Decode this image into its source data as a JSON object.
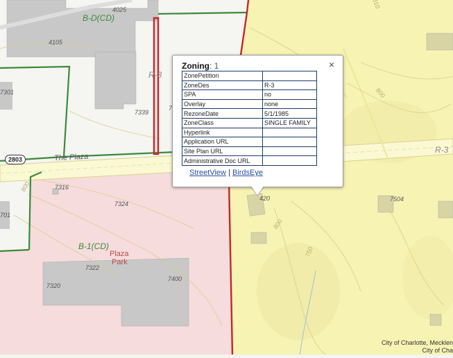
{
  "popup": {
    "title": "Zoning",
    "count": ": 1",
    "close": "×",
    "rows": [
      {
        "key": "ZonePetition",
        "value": ""
      },
      {
        "key": "ZoneDes",
        "value": "R-3"
      },
      {
        "key": "SPA",
        "value": "no"
      },
      {
        "key": "Overlay",
        "value": "none"
      },
      {
        "key": "RezoneDate",
        "value": "5/1/1985"
      },
      {
        "key": "ZoneClass",
        "value": "SINGLE FAMILY"
      },
      {
        "key": "Hyperlink",
        "value": ""
      },
      {
        "key": "Application URL",
        "value": ""
      },
      {
        "key": "Site Plan URL",
        "value": ""
      },
      {
        "key": "Administrative Doc URL",
        "value": ""
      }
    ],
    "link_streetview": "StreetView",
    "link_separator": "|",
    "link_birdseye": "BirdsEye"
  },
  "map": {
    "zone_labels": {
      "bd": "B-D(CD)",
      "r3_center": "R-3",
      "r3_right": "R-3",
      "b1": "B-1(CD)"
    },
    "road_name": "The Plaza",
    "road_shield": "2803",
    "park_label_1": "Plaza",
    "park_label_2": "Park",
    "addresses": {
      "a4025": "4025",
      "a4105": "4105",
      "a7301": "7301",
      "a7339": "7339",
      "a7316": "7316",
      "a7324": "7324",
      "a7322": "7322",
      "a7320": "7320",
      "a7400": "7400",
      "a7504": "7504",
      "a420": "420",
      "a701": "701",
      "a7": "7"
    },
    "contours": {
      "c800a": "800",
      "c800b": "800",
      "c800c": "800",
      "c750": "750",
      "c810": "810"
    },
    "attribution_1": "City of Charlotte, Mecklen",
    "attribution_2": "City of Cha"
  },
  "colors": {
    "r3_yellow": "#f7f3b3",
    "business_pink": "#f6dcdc",
    "building_gray": "#c8c8c8",
    "zone_green": "#3a8a3a",
    "zone_red": "#c0282a",
    "road_yellow": "#f8f4a0"
  }
}
